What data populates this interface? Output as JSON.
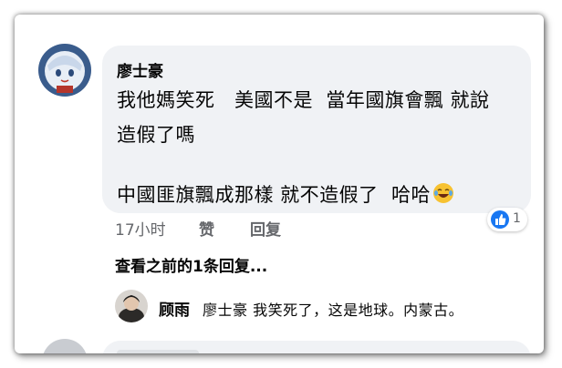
{
  "comment": {
    "author": "廖士豪",
    "line1": "我他媽笑死   美國不是  當年國旗會飄 就說",
    "line2": "造假了嗎",
    "line3": "中國匪旗飄成那樣 就不造假了  哈哈",
    "time": "17小时",
    "like_label": "赞",
    "reply_label": "回复",
    "reaction_count": "1"
  },
  "view_previous": "查看之前的1条回复...",
  "reply": {
    "author": "顾雨",
    "text": "廖士豪 我笑死了，这是地球。内蒙古。"
  },
  "colors": {
    "bubble": "#f0f2f5",
    "like_blue": "#1877f2",
    "meta_gray": "#65676b"
  },
  "icons": {
    "reaction": "like-thumb-icon",
    "emoji": "laughing-tears-emoji"
  }
}
